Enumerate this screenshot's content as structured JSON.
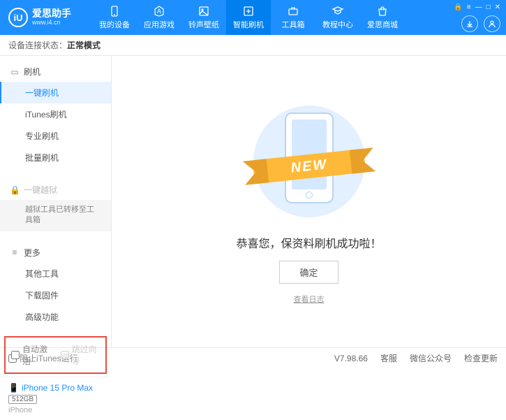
{
  "header": {
    "logo_text": "iU",
    "app_name": "爱思助手",
    "app_url": "www.i4.cn",
    "tabs": [
      {
        "label": "我的设备"
      },
      {
        "label": "应用游戏"
      },
      {
        "label": "铃声壁纸"
      },
      {
        "label": "智能刷机"
      },
      {
        "label": "工具箱"
      },
      {
        "label": "教程中心"
      },
      {
        "label": "爱思商城"
      }
    ]
  },
  "status": {
    "prefix": "设备连接状态：",
    "value": "正常模式"
  },
  "sidebar": {
    "flash": {
      "title": "刷机",
      "items": [
        "一键刷机",
        "iTunes刷机",
        "专业刷机",
        "批量刷机"
      ]
    },
    "jailbreak": {
      "title": "一键越狱",
      "sub": "越狱工具已转移至工具箱"
    },
    "more": {
      "title": "更多",
      "items": [
        "其他工具",
        "下载固件",
        "高级功能"
      ]
    },
    "auto_activate": "自动激活",
    "skip_guide": "跳过向导"
  },
  "device": {
    "name": "iPhone 15 Pro Max",
    "storage": "512GB",
    "type": "iPhone"
  },
  "main": {
    "ribbon": "NEW",
    "success": "恭喜您，保资料刷机成功啦！",
    "ok": "确定",
    "log": "查看日志"
  },
  "footer": {
    "block_itunes": "阻止iTunes运行",
    "version": "V7.98.66",
    "support": "客服",
    "wechat": "微信公众号",
    "update": "检查更新"
  }
}
